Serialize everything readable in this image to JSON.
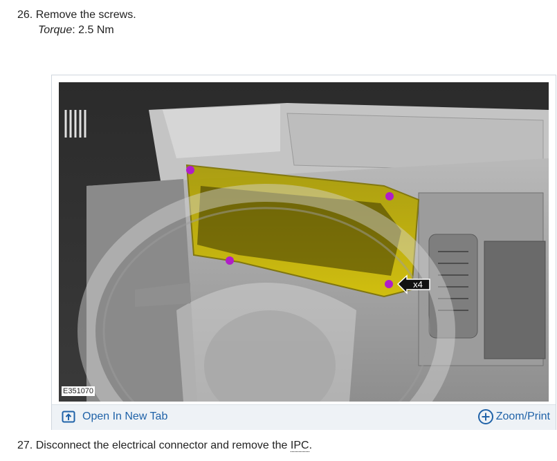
{
  "steps": [
    {
      "number": "26.",
      "text": "Remove the screws.",
      "torque_label": "Torque",
      "torque_value": ": 2.5 Nm"
    },
    {
      "number": "27.",
      "text_before": "Disconnect the electrical connector and remove the",
      "abbreviation": "IPC",
      "text_after": "."
    }
  ],
  "figure": {
    "id": "E351070",
    "callout": "x4",
    "open_tab_label": "Open In New Tab",
    "zoom_label": "Zoom/Print"
  },
  "colors": {
    "link": "#1f62a8",
    "highlight_part": "#c8b400",
    "screw_marker": "#b01ec8",
    "bar_background": "#eef2f6"
  },
  "icons": {
    "open_tab": "open-new-tab-icon",
    "zoom": "plus-circle-icon"
  }
}
